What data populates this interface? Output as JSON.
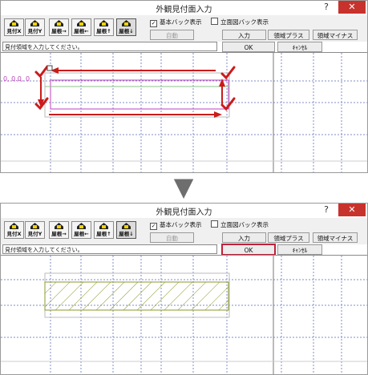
{
  "window": {
    "title": "外観見付面入力",
    "help": "?",
    "close": "✕"
  },
  "toolbar": {
    "buttons": [
      {
        "name": "見付X"
      },
      {
        "name": "見付Y"
      },
      {
        "name": "屋根→"
      },
      {
        "name": "屋根←"
      },
      {
        "name": "屋根↑"
      },
      {
        "name": "屋根↓"
      }
    ]
  },
  "options": {
    "base_back": {
      "label": "基本バック表示",
      "checked": true
    },
    "elev_back": {
      "label": "立面図バック表示",
      "checked": false
    }
  },
  "buttons": {
    "auto": "自動",
    "input": "入力",
    "area_plus": "領域プラス",
    "area_minus": "領域マイナス",
    "ok": "OK",
    "cancel": "ｷｬﾝｾﾙ"
  },
  "status": "見付領域を入力してください。",
  "coord_readout": "0, 0.0, 0",
  "separator": "▼",
  "colors": {
    "arrow": "#cc1a1a",
    "hatch": "#8a9a2a",
    "grid": "#7f8cc8",
    "focus": "#c0203a"
  }
}
